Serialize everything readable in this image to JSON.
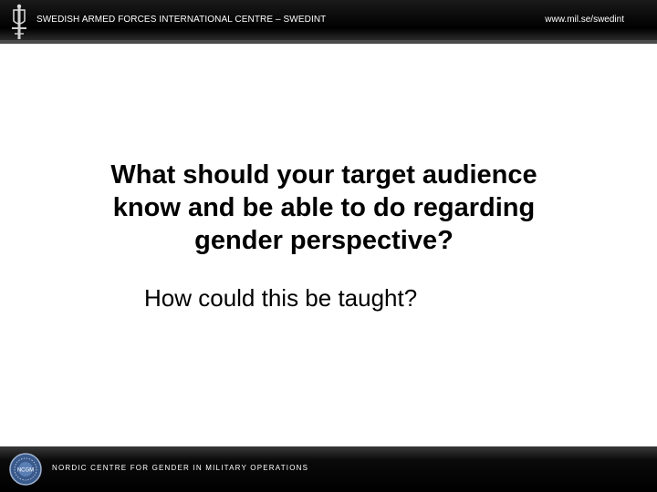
{
  "header": {
    "title": "SWEDISH ARMED FORCES INTERNATIONAL CENTRE – SWEDINT",
    "url": "www.mil.se/swedint",
    "logo_icon": "swedish-armed-forces-emblem"
  },
  "content": {
    "question_lines": [
      "What should your target audience",
      "know and be able to do regarding",
      "gender perspective?"
    ],
    "subquestion": "How could this be taught?"
  },
  "footer": {
    "text": "NORDIC CENTRE FOR GENDER IN MILITARY OPERATIONS",
    "logo_icon": "nordic-centre-emblem",
    "logo_text": "NCGM"
  },
  "colors": {
    "bar_background": "#000000",
    "bar_text": "#ffffff",
    "slide_background": "#ffffff",
    "body_text": "#000000",
    "emblem_blue": "#3a5a8c"
  }
}
